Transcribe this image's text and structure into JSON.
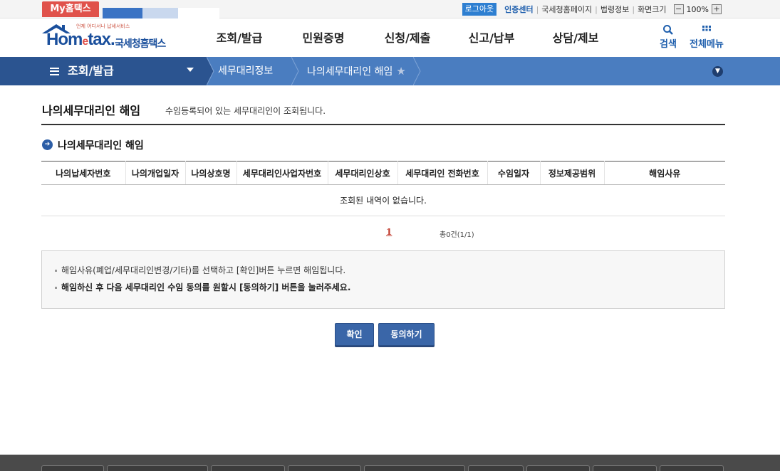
{
  "util": {
    "my_tab": "My홈택스",
    "logout": "로그아웃",
    "cert_center": "인증센터",
    "links": [
      "국세청홈페이지",
      "법령정보",
      "화면크기"
    ],
    "zoom_minus": "−",
    "zoom_value": "100%",
    "zoom_plus": "+"
  },
  "header": {
    "logo_sub": "언제 어디서나 납세서비스",
    "logo_main_a": "Hom",
    "logo_main_e": "e",
    "logo_main_b": "tax.",
    "logo_korean": "국세청홈택스",
    "gnb": [
      "조회/발급",
      "민원증명",
      "신청/제출",
      "신고/납부",
      "상담/제보"
    ],
    "search_label": "검색",
    "all_menu_label": "전체메뉴"
  },
  "location": {
    "menu": "조회/발급",
    "crumbs": [
      "세무대리정보",
      "나의세무대리인 해임"
    ]
  },
  "page": {
    "title": "나의세무대리인 해임",
    "description": "수임등록되어 있는 세무대리인이 조회됩니다.",
    "section_title": "나의세무대리인 해임"
  },
  "table": {
    "headers": [
      "나의납세자번호",
      "나의개업일자",
      "나의상호명",
      "세무대리인사업자번호",
      "세무대리인상호",
      "세무대리인 전화번호",
      "수임일자",
      "정보제공범위",
      "해임사유"
    ],
    "empty_message": "조회된 내역이 없습니다."
  },
  "pagination": {
    "current_page": "1",
    "total": "총0건(1/1)"
  },
  "notice": {
    "line1": "해임사유(폐업/세무대리인변경/기타)를 선택하고 [확인]버튼 누르면 해임됩니다.",
    "line2": "해임하신 후 다음 세무대리인 수임 동의를 원할시 [동의하기] 버튼을 눌러주세요."
  },
  "buttons": {
    "confirm": "확인",
    "agree": "동의하기"
  },
  "colors": {
    "brand_blue": "#1a4f9c",
    "location_bar": "#4a7dc0",
    "location_main": "#2b5490",
    "my_tab": "#e0524b",
    "button": "#3a66a8"
  }
}
